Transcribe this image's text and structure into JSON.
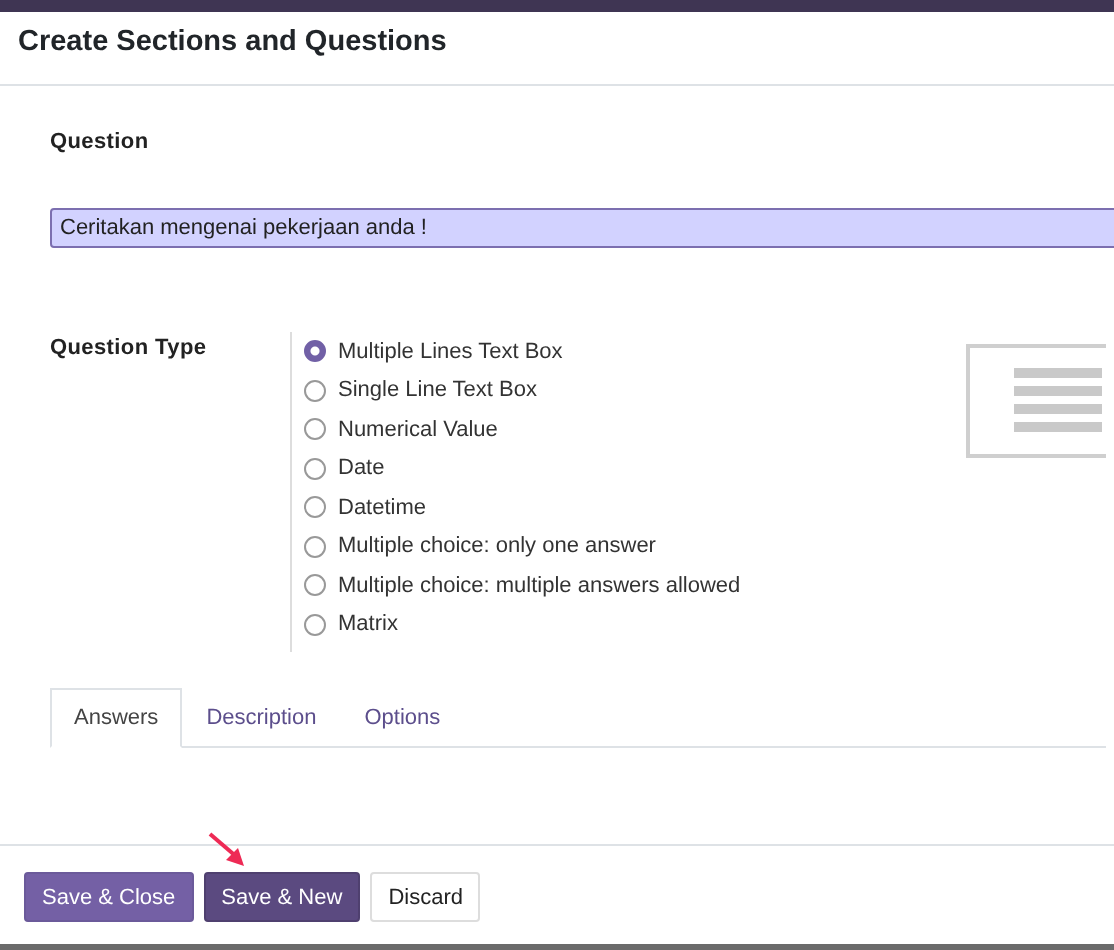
{
  "dialog": {
    "title": "Create Sections and Questions"
  },
  "question": {
    "label": "Question",
    "value": "Ceritakan mengenai pekerjaan anda !"
  },
  "question_type": {
    "label": "Question Type",
    "options": [
      {
        "label": "Multiple Lines Text Box",
        "selected": true
      },
      {
        "label": "Single Line Text Box",
        "selected": false
      },
      {
        "label": "Numerical Value",
        "selected": false
      },
      {
        "label": "Date",
        "selected": false
      },
      {
        "label": "Datetime",
        "selected": false
      },
      {
        "label": "Multiple choice: only one answer",
        "selected": false
      },
      {
        "label": "Multiple choice: multiple answers allowed",
        "selected": false
      },
      {
        "label": "Matrix",
        "selected": false
      }
    ]
  },
  "tabs": [
    {
      "label": "Answers",
      "selected": true
    },
    {
      "label": "Description",
      "selected": false
    },
    {
      "label": "Options",
      "selected": false
    }
  ],
  "buttons": [
    {
      "label": "Save & Close",
      "kind": "primary"
    },
    {
      "label": "Save & New",
      "kind": "dark"
    },
    {
      "label": "Discard",
      "kind": "plain"
    }
  ]
}
